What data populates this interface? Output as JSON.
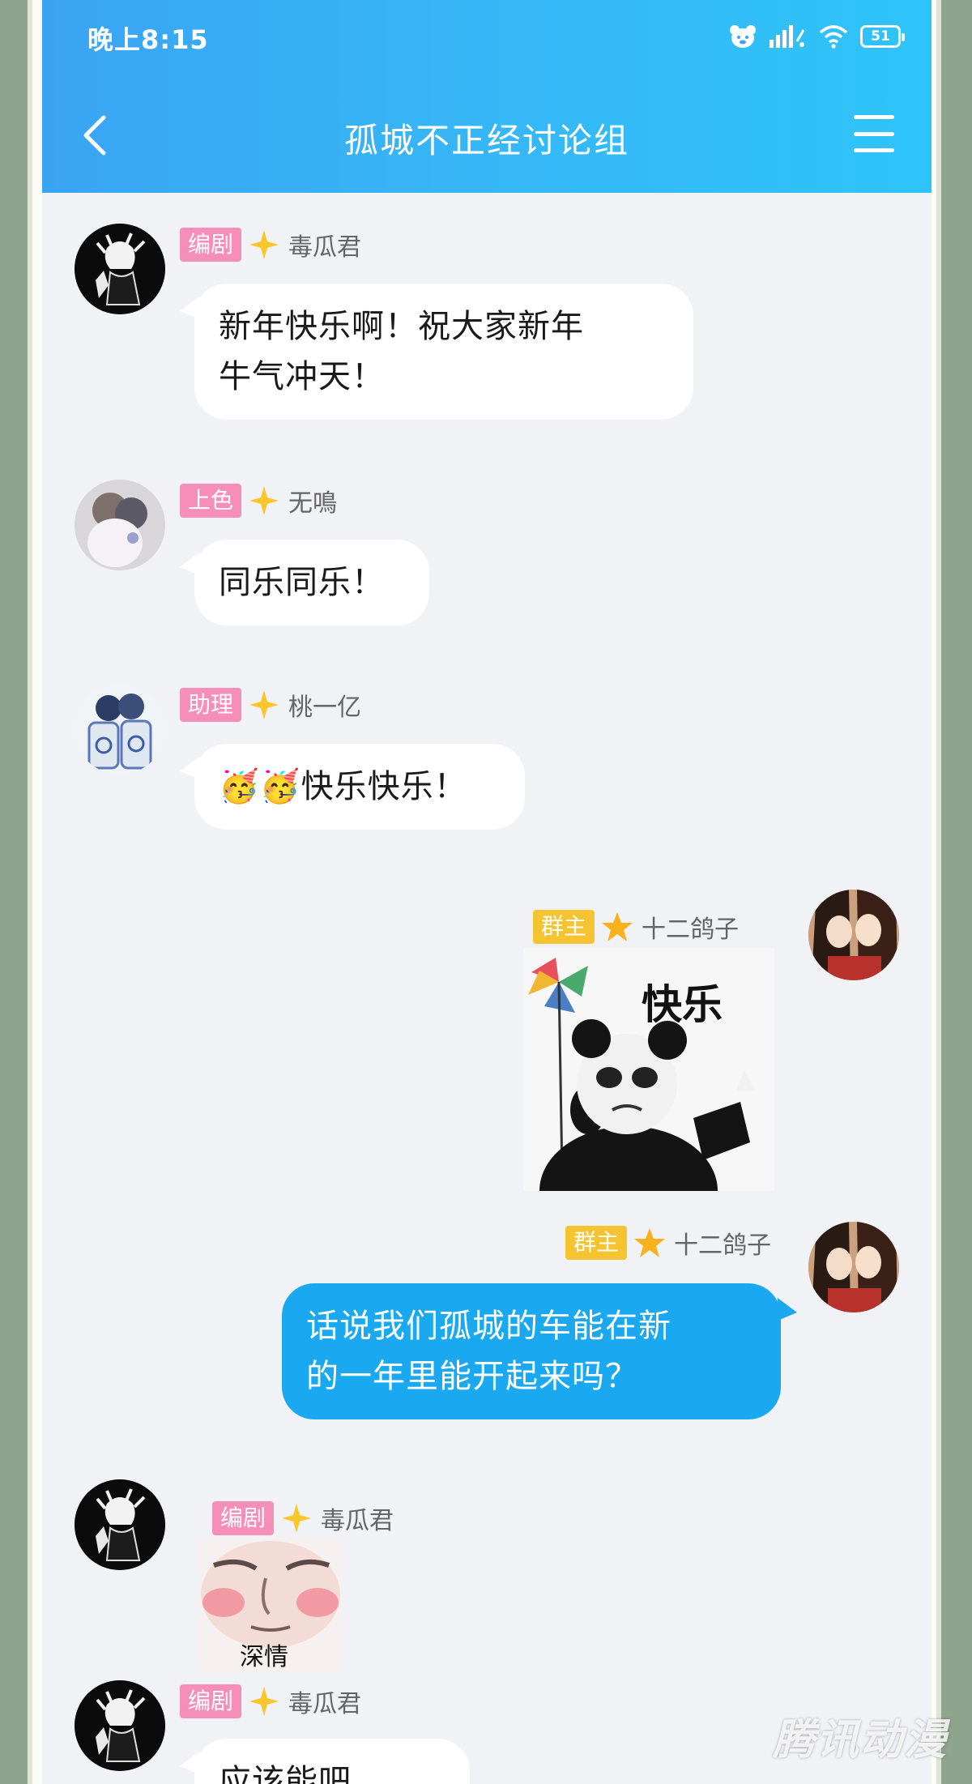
{
  "status_bar": {
    "time": "晚上8:15",
    "battery": "51"
  },
  "header": {
    "title": "孤城不正经讨论组"
  },
  "colors": {
    "header_gradient": [
      "#3aa4f3",
      "#2ec4f9"
    ],
    "self_bubble": "#1aa9f0",
    "role_pink": "#f58fb9",
    "role_yellow": "#f7c431"
  },
  "messages": [
    {
      "role": "编剧",
      "sender": "毒瓜君",
      "text_line1": "新年快乐啊！祝大家新年",
      "text_line2": "牛气冲天！"
    },
    {
      "role": "上色",
      "sender": "无鳴",
      "text": "同乐同乐！"
    },
    {
      "role": "助理",
      "sender": "桃一亿",
      "emoji": "🥳🥳",
      "text": "快乐快乐！"
    },
    {
      "role": "群主",
      "sender": "十二鸽子",
      "sticker_text": "快乐"
    },
    {
      "role": "群主",
      "sender": "十二鸽子",
      "text_line1": "话说我们孤城的车能在新",
      "text_line2": "的一年里能开起来吗？"
    },
    {
      "role": "编剧",
      "sender": "毒瓜君",
      "sticker_text": "深情"
    },
    {
      "role": "编剧",
      "sender": "毒瓜君",
      "text": "应该能吧"
    }
  ],
  "watermark": "腾讯动漫"
}
